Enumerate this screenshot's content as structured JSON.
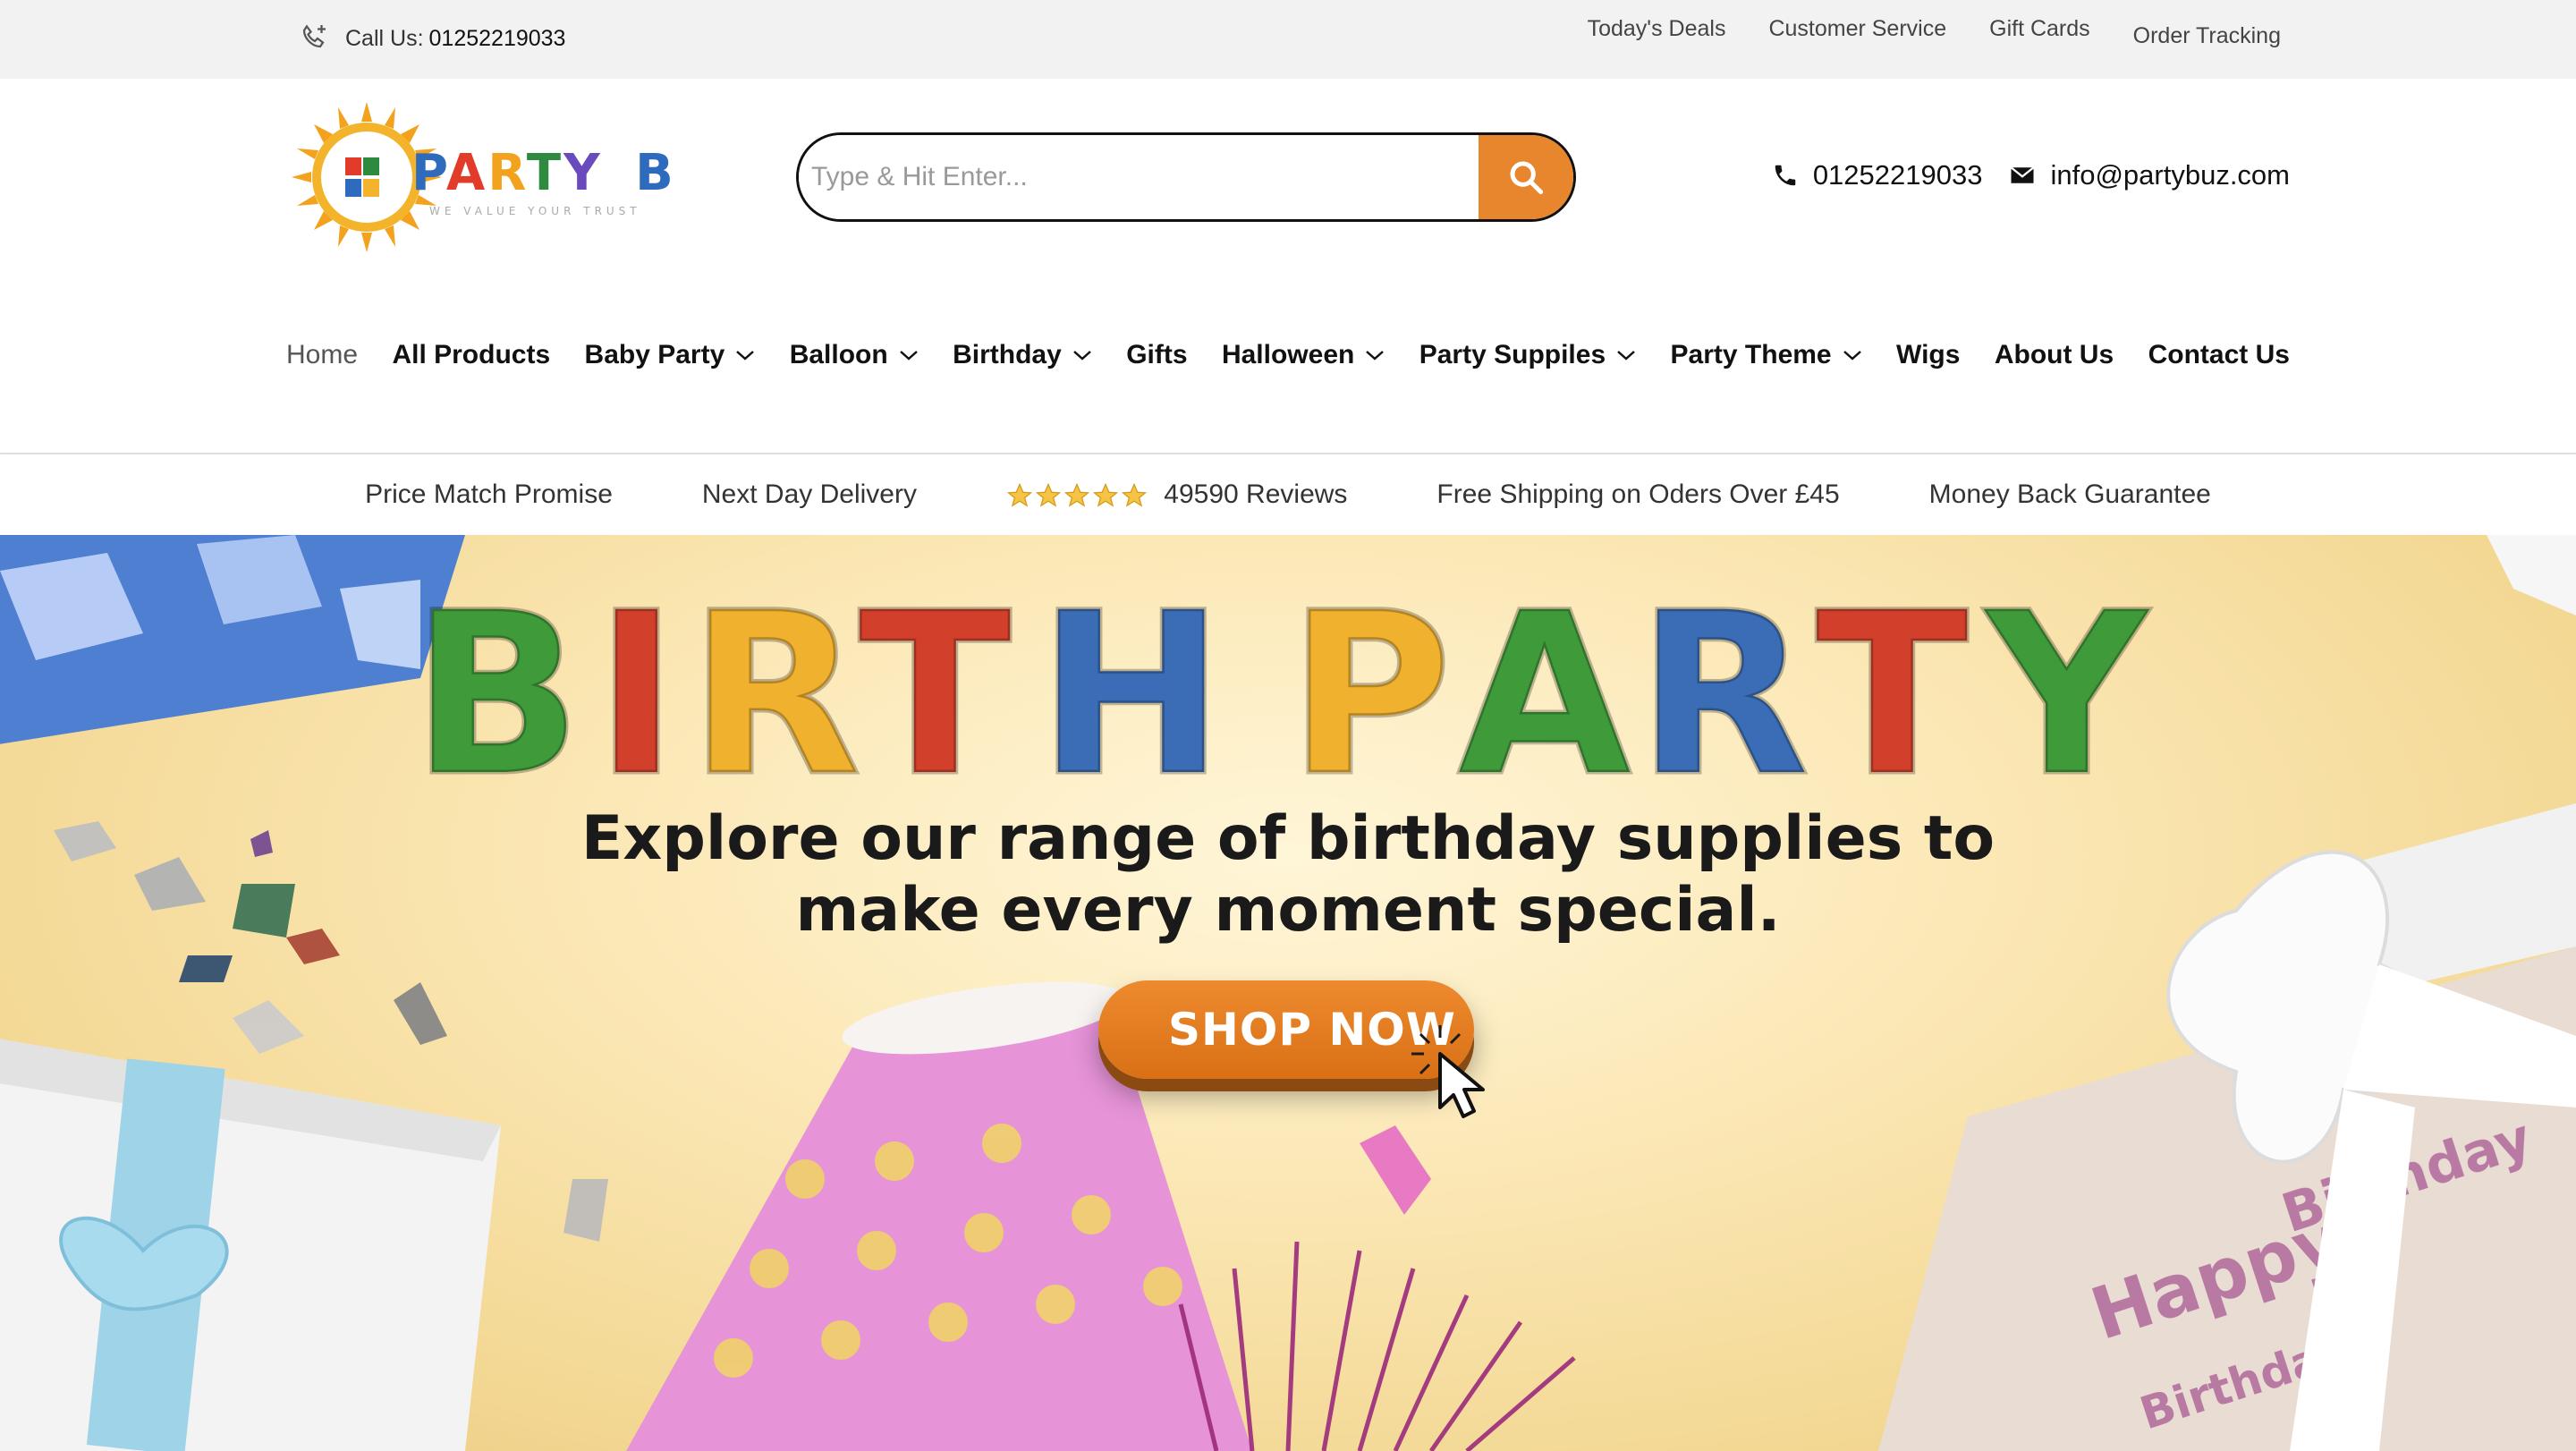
{
  "topbar": {
    "call_label": "Call Us:",
    "call_number": "01252219033",
    "links": [
      "Today's Deals",
      "Customer Service",
      "Gift Cards",
      "Order Tracking"
    ]
  },
  "header": {
    "logo": {
      "text": "PARTY BUZ",
      "tagline": "WE VALUE YOUR TRUST"
    },
    "search": {
      "placeholder": "Type & Hit Enter...",
      "value": ""
    },
    "phone": "01252219033",
    "email": "info@partybuz.com"
  },
  "nav": {
    "items": [
      {
        "label": "Home",
        "dropdown": false
      },
      {
        "label": "All Products",
        "dropdown": false
      },
      {
        "label": "Baby Party",
        "dropdown": true
      },
      {
        "label": "Balloon",
        "dropdown": true
      },
      {
        "label": "Birthday",
        "dropdown": true
      },
      {
        "label": "Gifts",
        "dropdown": false
      },
      {
        "label": "Halloween",
        "dropdown": true
      },
      {
        "label": "Party Suppiles",
        "dropdown": true
      },
      {
        "label": "Party Theme",
        "dropdown": true
      },
      {
        "label": "Wigs",
        "dropdown": false
      },
      {
        "label": "About Us",
        "dropdown": false
      },
      {
        "label": "Contact Us",
        "dropdown": false
      }
    ]
  },
  "promise_bar": {
    "items": [
      "Price Match Promise",
      "Next Day Delivery",
      "49590 Reviews",
      "Free Shipping on Oders Over £45",
      "Money Back Guarantee"
    ],
    "star_count": 5
  },
  "hero": {
    "headline_letters": [
      "B",
      "I",
      "R",
      "T",
      "H",
      " ",
      "P",
      "A",
      "R",
      "T",
      "Y"
    ],
    "headline": "BIRTH PARTY",
    "subtitle_line1": "Explore our range of birthday supplies to",
    "subtitle_line2": "make every moment special.",
    "cta": "SHOP NOW"
  },
  "colors": {
    "accent_orange": "#e8862d",
    "letter_green": "#3f9b3a",
    "letter_red": "#d2402c",
    "letter_yellow": "#f0b12e",
    "letter_blue": "#3a6db5"
  }
}
